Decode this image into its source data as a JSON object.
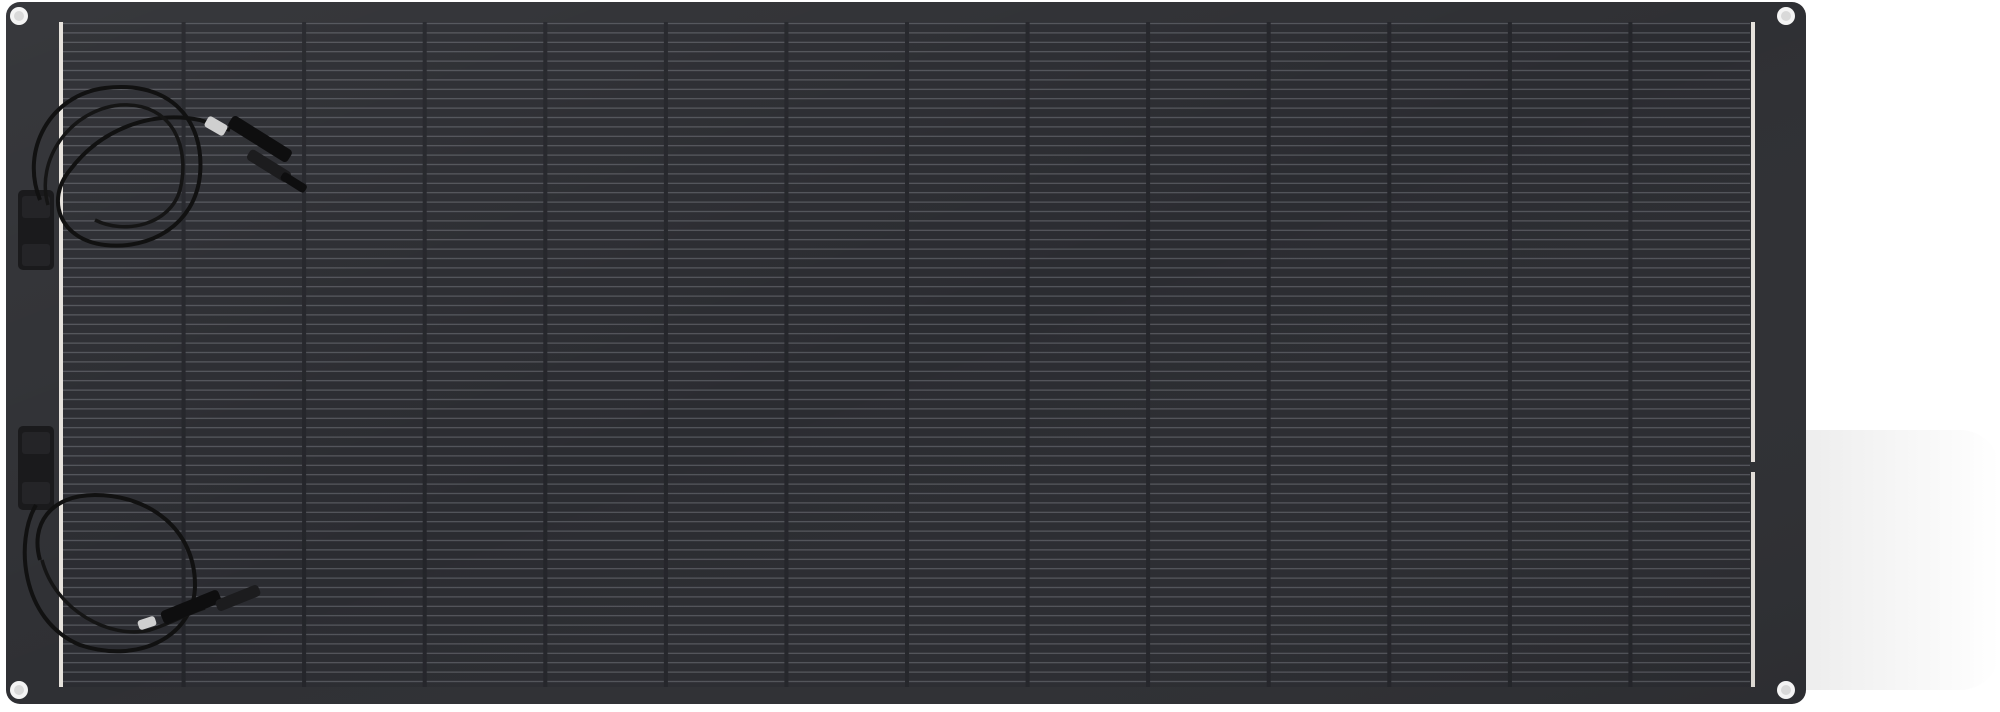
{
  "product": {
    "subject": "flexible-solar-panel",
    "icons": [
      "mounting-hole-icon",
      "junction-box-icon",
      "mc4-connector-icon",
      "cable-icon"
    ],
    "colors": {
      "panel_backsheet": "#2f3034",
      "cell_area": "#2a2b30",
      "cell_gridline": "#5b5d63",
      "busbar": "#e8e4de",
      "cable": "#111111",
      "background": "#ffffff"
    },
    "cell_grid": {
      "columns": 14,
      "finger_rows": 58
    },
    "junction_boxes": 2,
    "mounting_holes": 4
  }
}
